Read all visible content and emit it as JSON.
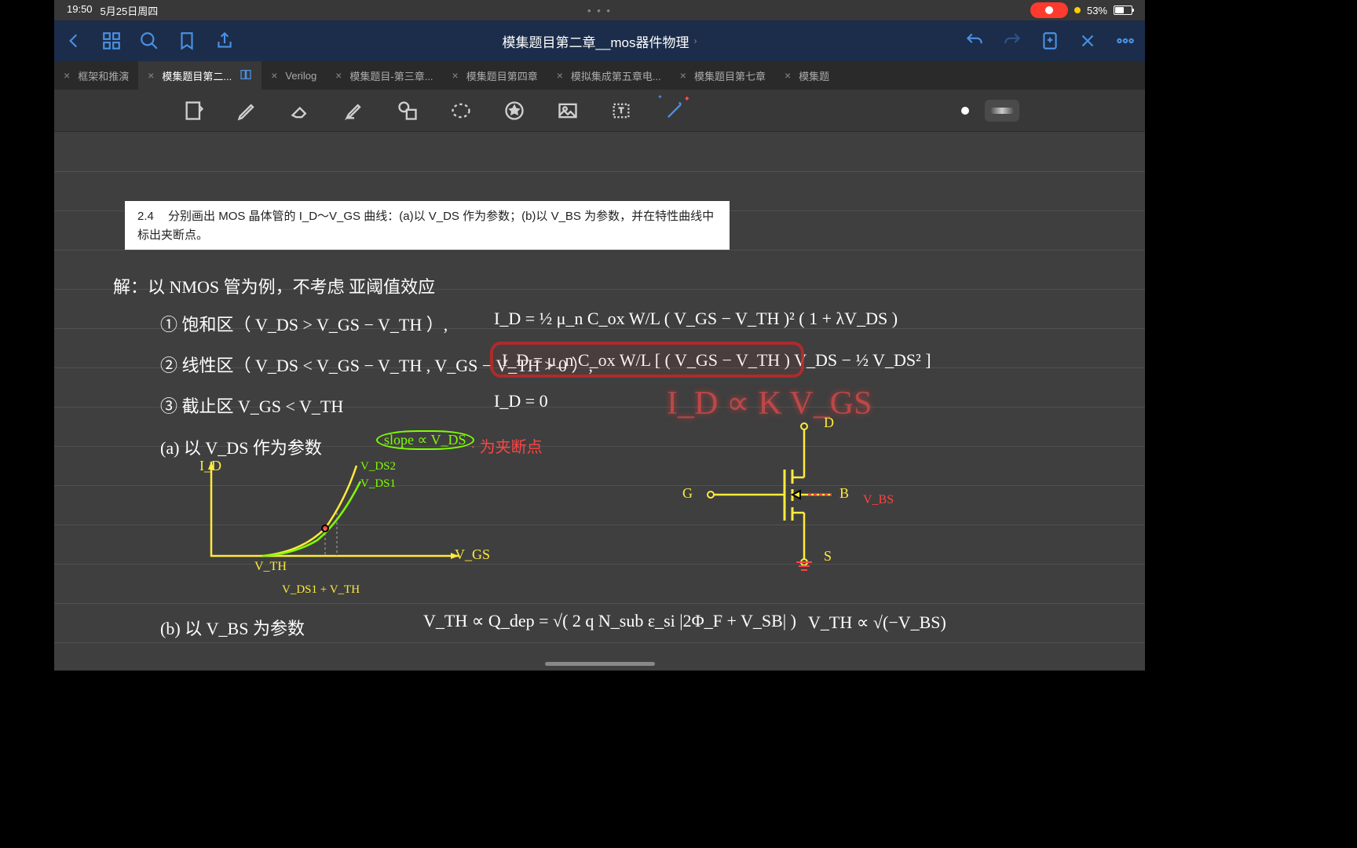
{
  "status": {
    "time": "19:50",
    "date": "5月25日周四",
    "dots": "• • •",
    "battery_pct": "53%"
  },
  "nav": {
    "title": "模集题目第二章__mos器件物理",
    "chevron": "›"
  },
  "tabs": [
    {
      "label": "框架和推演",
      "active": false
    },
    {
      "label": "模集题目第二...",
      "active": true,
      "hasIcon": true
    },
    {
      "label": "Verilog",
      "active": false
    },
    {
      "label": "模集题目-第三章...",
      "active": false
    },
    {
      "label": "模集题目第四章",
      "active": false
    },
    {
      "label": "模拟集成第五章电...",
      "active": false
    },
    {
      "label": "模集题目第七章",
      "active": false
    },
    {
      "label": "模集题",
      "active": false
    }
  ],
  "problem": {
    "num": "2.4",
    "text": "分别画出 MOS 晶体管的 I_D～V_GS 曲线：(a)以 V_DS 作为参数；(b)以 V_BS 为参数，并在特性曲线中标出夹断点。"
  },
  "notes": {
    "l1": "解：以 NMOS 管为例，不考虑 亚阈值效应",
    "l2a": "① 饱和区（ V_DS > V_GS − V_TH ）,",
    "l2b": "I_D = ½ μ_n C_ox W/L ( V_GS − V_TH )²   ( 1 + λV_DS )",
    "l3a": "② 线性区（ V_DS < V_GS − V_TH ,  V_GS − V_TH > 0 ）,",
    "l3b": "I_D =  μ_n C_ox W/L [ ( V_GS − V_TH ) V_DS − ½ V_DS² ]",
    "l4a": "③ 截止区   V_GS < V_TH",
    "l4b": "I_D  =   0",
    "l5": "(a) 以 V_DS 作为参数",
    "slope": "slope ∝ V_DS",
    "pinch": "· 为夹断点",
    "axis_y": "I_D",
    "axis_x": "V_GS",
    "vth": "V_TH",
    "vds1": "V_DS1",
    "vds2": "V_DS2",
    "vds1vth": "V_DS1 + V_TH",
    "glow": "I_D  ∝ K V_GS",
    "mos_g": "G",
    "mos_d": "D",
    "mos_s": "S",
    "mos_b": "B",
    "mos_vbs": "V_BS",
    "l6": "(b) 以 V_BS 为参数",
    "l6b": "V_TH  ∝  Q_dep = √( 2 q N_sub ε_si |2Φ_F + V_SB| )",
    "l6c": "V_TH  ∝  √(−V_BS)"
  }
}
